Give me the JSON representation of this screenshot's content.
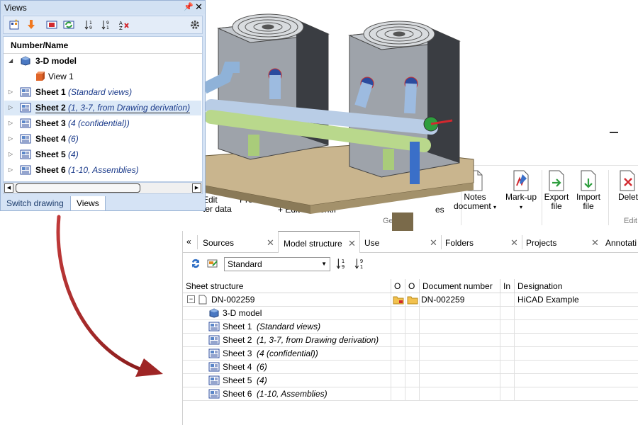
{
  "ribbon": {
    "edit_data_label_1": "Edit",
    "edit_data_label_2": "ter data",
    "prescid_label": "Prescid",
    "edit_label": "+ Edit",
    "workflow_label": "Workfl",
    "es_label": "es",
    "notes_label_1": "Notes",
    "notes_label_2": "document",
    "markup_label": "Mark-up",
    "export_label_1": "Export",
    "export_label_2": "file",
    "import_label_1": "Import",
    "import_label_2": "file",
    "delete_label": "Delet",
    "group_general": "Gen",
    "group_edit": "Edit"
  },
  "views_panel": {
    "title": "Views",
    "column_header": "Number/Name",
    "model_label": "3-D model",
    "view1_label": "View 1",
    "sheets": [
      {
        "name": "Sheet 1",
        "detail": "(Standard views)"
      },
      {
        "name": "Sheet 2",
        "detail": "(1, 3-7, from Drawing derivation)"
      },
      {
        "name": "Sheet 3",
        "detail": "(4 (confidential))"
      },
      {
        "name": "Sheet 4",
        "detail": "(6)"
      },
      {
        "name": "Sheet 5",
        "detail": "(4)"
      },
      {
        "name": "Sheet 6",
        "detail": "(1-10, Assemblies)"
      }
    ],
    "tab_switch": "Switch drawing",
    "tab_views": "Views"
  },
  "dock": {
    "tabs": [
      "Sources",
      "Model structure",
      "Use",
      "Folders",
      "Projects",
      "Annotati"
    ],
    "combo_value": "Standard",
    "columns": [
      "Sheet structure",
      "O",
      "O",
      "Document number",
      "In",
      "Designation"
    ],
    "root": {
      "name": "DN-002259",
      "docnum": "DN-002259",
      "designation": "HiCAD Example"
    },
    "model_label": "3-D model",
    "sheets": [
      {
        "name": "Sheet 1",
        "detail": "(Standard views)"
      },
      {
        "name": "Sheet 2",
        "detail": "(1, 3-7, from Drawing derivation)"
      },
      {
        "name": "Sheet 3",
        "detail": "(4 (confidential))"
      },
      {
        "name": "Sheet 4",
        "detail": "(6)"
      },
      {
        "name": "Sheet 5",
        "detail": "(4)"
      },
      {
        "name": "Sheet 6",
        "detail": "(1-10, Assemblies)"
      }
    ]
  },
  "colors": {
    "panel_bg": "#d5e3f5",
    "selection": "#dce9f7",
    "arrow": "#a52a2a"
  }
}
